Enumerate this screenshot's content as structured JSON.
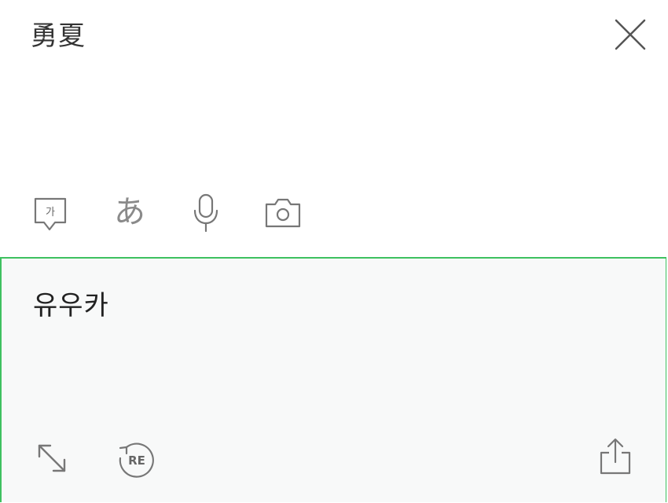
{
  "source": {
    "text": "勇夏",
    "close_icon": "close-icon"
  },
  "input_tools": {
    "handwriting": {
      "icon": "handwriting-icon",
      "glyph": "가"
    },
    "japanese": {
      "icon": "japanese-input-icon",
      "glyph": "あ"
    },
    "voice": {
      "icon": "microphone-icon"
    },
    "camera": {
      "icon": "camera-icon"
    }
  },
  "result": {
    "text": "유우카",
    "expand_icon": "expand-icon",
    "retranslate": {
      "icon": "retranslate-icon",
      "label": "RE"
    },
    "share_icon": "share-icon"
  },
  "colors": {
    "accent": "#3ec160",
    "result_bg": "#f8f9f9",
    "icon": "#777777",
    "text": "#333333"
  }
}
